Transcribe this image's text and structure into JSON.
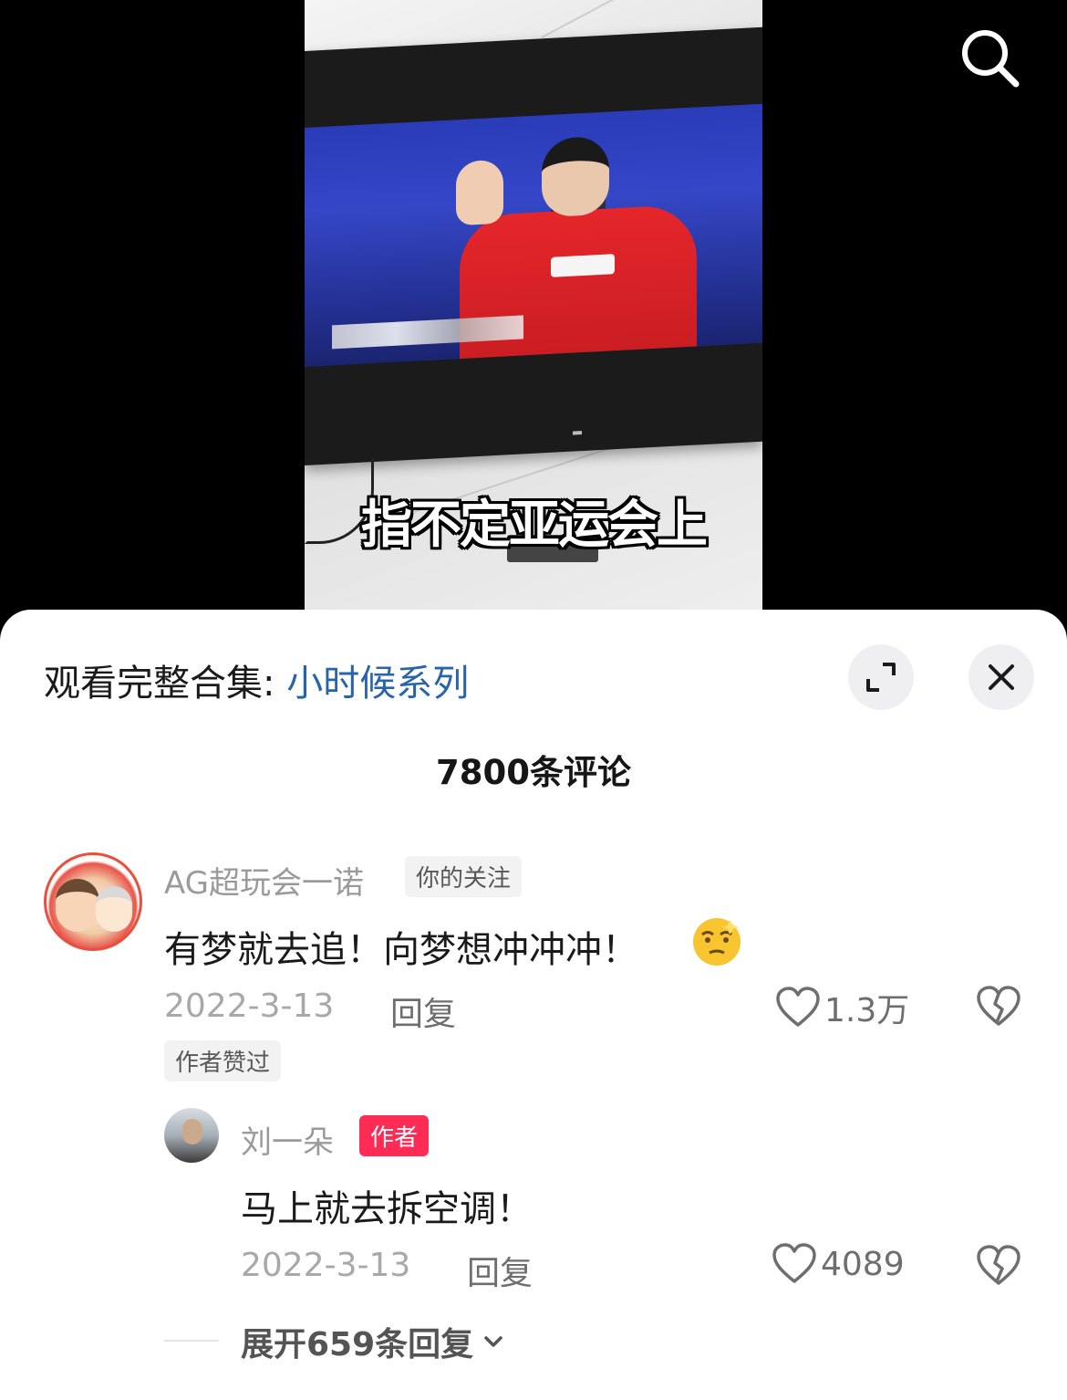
{
  "video": {
    "subtitle": "指不定亚运会上"
  },
  "header": {
    "prefix": "观看完整合集: ",
    "collection": "小时候系列"
  },
  "comments_count": "7800条评论",
  "comment": {
    "user": "AG超玩会一诺",
    "user_tag": "你的关注",
    "text": "有梦就去追！向梦想冲冲冲！",
    "date": "2022-3-13",
    "reply_label": "回复",
    "likes": "1.3万",
    "author_liked_tag": "作者赞过"
  },
  "reply": {
    "user": "刘一朵",
    "user_tag": "作者",
    "text": "马上就去拆空调！",
    "date": "2022-3-13",
    "reply_label": "回复",
    "likes": "4089"
  },
  "expand_label": "展开659条回复",
  "colors": {
    "link": "#2a64a8",
    "author_tag": "#fe2c55"
  },
  "icons": [
    "search-icon",
    "fullscreen-icon",
    "close-icon",
    "heart-icon",
    "broken-heart-icon",
    "chevron-down-icon",
    "thinking-face-emoji"
  ]
}
